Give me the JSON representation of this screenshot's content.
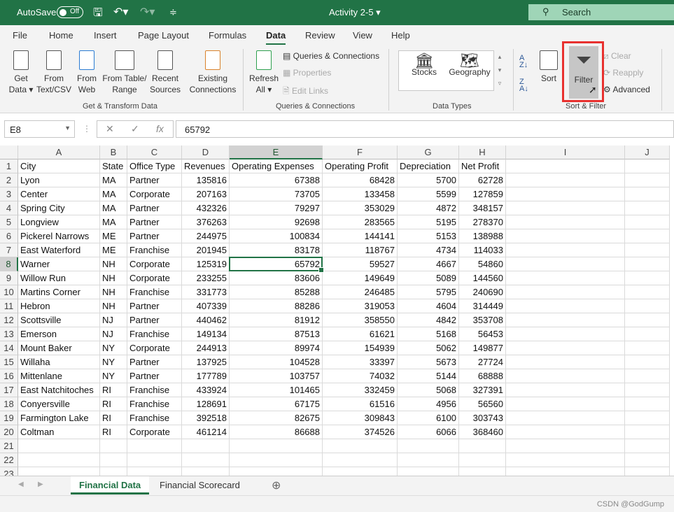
{
  "titlebar": {
    "autosave": "AutoSave",
    "toggle": "Off",
    "title": "Activity 2-5 ▾",
    "search": "Search"
  },
  "tabs": [
    "File",
    "Home",
    "Insert",
    "Page Layout",
    "Formulas",
    "Data",
    "Review",
    "View",
    "Help"
  ],
  "active_tab": "Data",
  "ribbon": {
    "get_data": [
      "Get",
      "Data ▾"
    ],
    "from_text": [
      "From",
      "Text/CSV"
    ],
    "from_web": [
      "From",
      "Web"
    ],
    "from_table": [
      "From Table/",
      "Range"
    ],
    "recent": [
      "Recent",
      "Sources"
    ],
    "existing": [
      "Existing",
      "Connections"
    ],
    "group1": "Get & Transform Data",
    "refresh": [
      "Refresh",
      "All ▾"
    ],
    "queries": "Queries & Connections",
    "properties": "Properties",
    "edit_links": "Edit Links",
    "group2": "Queries & Connections",
    "stocks": "Stocks",
    "geography": "Geography",
    "group3": "Data Types",
    "sort": "Sort",
    "filter": "Filter",
    "clear": "Clear",
    "reapply": "Reapply",
    "advanced": "Advanced",
    "group4": "Sort & Filter"
  },
  "formula_bar": {
    "name_box": "E8",
    "fx": "fx",
    "value": "65792"
  },
  "sheet": {
    "columns": [
      "A",
      "B",
      "C",
      "D",
      "E",
      "F",
      "G",
      "H",
      "I",
      "J"
    ],
    "selected": {
      "col": "E",
      "row": 8
    },
    "headers": [
      "City",
      "State",
      "Office Type",
      "Revenues",
      "Operating Expenses",
      "Operating Profit",
      "Depreciation",
      "Net Profit"
    ],
    "rows": [
      [
        "Lyon",
        "MA",
        "Partner",
        135816,
        67388,
        68428,
        5700,
        62728
      ],
      [
        "Center",
        "MA",
        "Corporate",
        207163,
        73705,
        133458,
        5599,
        127859
      ],
      [
        "Spring City",
        "MA",
        "Partner",
        432326,
        79297,
        353029,
        4872,
        348157
      ],
      [
        "Longview",
        "MA",
        "Partner",
        376263,
        92698,
        283565,
        5195,
        278370
      ],
      [
        "Pickerel Narrows",
        "ME",
        "Partner",
        244975,
        100834,
        144141,
        5153,
        138988
      ],
      [
        "East Waterford",
        "ME",
        "Franchise",
        201945,
        83178,
        118767,
        4734,
        114033
      ],
      [
        "Warner",
        "NH",
        "Corporate",
        125319,
        65792,
        59527,
        4667,
        54860
      ],
      [
        "Willow Run",
        "NH",
        "Corporate",
        233255,
        83606,
        149649,
        5089,
        144560
      ],
      [
        "Martins Corner",
        "NH",
        "Franchise",
        331773,
        85288,
        246485,
        5795,
        240690
      ],
      [
        "Hebron",
        "NH",
        "Partner",
        407339,
        88286,
        319053,
        4604,
        314449
      ],
      [
        "Scottsville",
        "NJ",
        "Partner",
        440462,
        81912,
        358550,
        4842,
        353708
      ],
      [
        "Emerson",
        "NJ",
        "Franchise",
        149134,
        87513,
        61621,
        5168,
        56453
      ],
      [
        "Mount Baker",
        "NY",
        "Corporate",
        244913,
        89974,
        154939,
        5062,
        149877
      ],
      [
        "Willaha",
        "NY",
        "Partner",
        137925,
        104528,
        33397,
        5673,
        27724
      ],
      [
        "Mittenlane",
        "NY",
        "Partner",
        177789,
        103757,
        74032,
        5144,
        68888
      ],
      [
        "East Natchitoches",
        "RI",
        "Franchise",
        433924,
        101465,
        332459,
        5068,
        327391
      ],
      [
        "Conyersville",
        "RI",
        "Franchise",
        128691,
        67175,
        61516,
        4956,
        56560
      ],
      [
        "Farmington Lake",
        "RI",
        "Franchise",
        392518,
        82675,
        309843,
        6100,
        303743
      ],
      [
        "Coltman",
        "RI",
        "Corporate",
        461214,
        86688,
        374526,
        6066,
        368460
      ]
    ],
    "row_count": 23
  },
  "sheet_tabs": [
    "Financial Data",
    "Financial Scorecard"
  ],
  "active_sheet": "Financial Data",
  "watermark": "CSDN @GodGump",
  "colors": {
    "accent": "#217346",
    "highlight": "#e8312f"
  }
}
